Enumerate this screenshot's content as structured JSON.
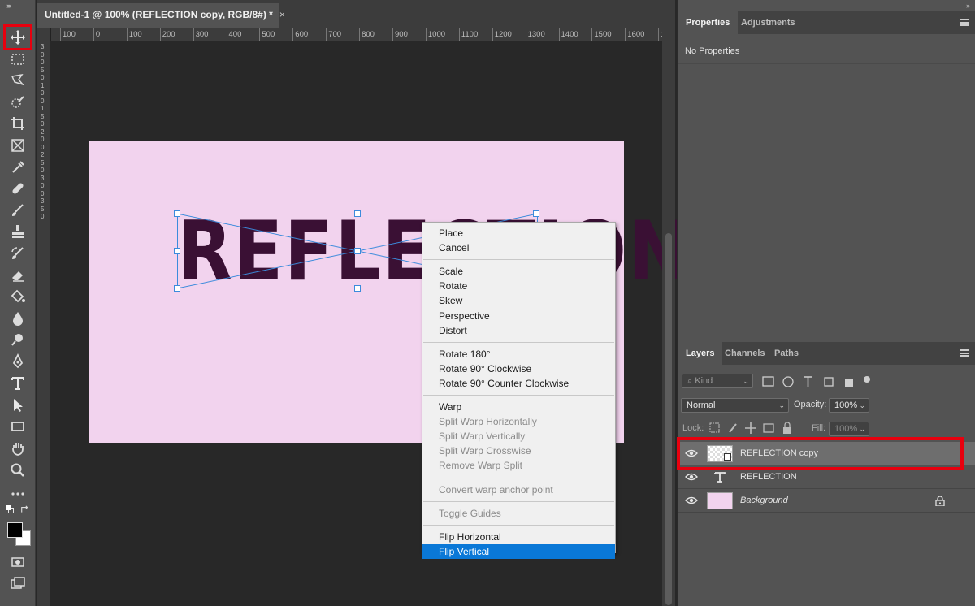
{
  "document_tab": {
    "title": "Untitled-1 @ 100% (REFLECTION copy, RGB/8#) *",
    "close": "×"
  },
  "ruler": {
    "h_ticks": [
      "100",
      "0",
      "100",
      "200",
      "300",
      "400",
      "500",
      "600",
      "700",
      "800",
      "900",
      "1000",
      "1100",
      "1200",
      "1300",
      "1400",
      "1500",
      "1600",
      "1700"
    ],
    "v_ticks": [
      "3",
      "0",
      "0",
      "5",
      "0",
      "1",
      "0",
      "0",
      "1",
      "5",
      "0",
      "2",
      "0",
      "0",
      "2",
      "5",
      "0",
      "3",
      "0",
      "0",
      "3",
      "5",
      "0"
    ]
  },
  "canvas": {
    "text": "REFLECTION",
    "background_color": "#f2d3ee",
    "text_color": "#3a1034"
  },
  "context_menu": {
    "groups": [
      [
        {
          "label": "Place",
          "enabled": true
        },
        {
          "label": "Cancel",
          "enabled": true
        }
      ],
      [
        {
          "label": "Scale",
          "enabled": true
        },
        {
          "label": "Rotate",
          "enabled": true
        },
        {
          "label": "Skew",
          "enabled": true
        },
        {
          "label": "Perspective",
          "enabled": true
        },
        {
          "label": "Distort",
          "enabled": true
        }
      ],
      [
        {
          "label": "Rotate 180°",
          "enabled": true
        },
        {
          "label": "Rotate 90° Clockwise",
          "enabled": true
        },
        {
          "label": "Rotate 90° Counter Clockwise",
          "enabled": true
        }
      ],
      [
        {
          "label": "Warp",
          "enabled": true
        },
        {
          "label": "Split Warp Horizontally",
          "enabled": false
        },
        {
          "label": "Split Warp Vertically",
          "enabled": false
        },
        {
          "label": "Split Warp Crosswise",
          "enabled": false
        },
        {
          "label": "Remove Warp Split",
          "enabled": false
        }
      ],
      [
        {
          "label": "Convert warp anchor point",
          "enabled": false
        }
      ],
      [
        {
          "label": "Toggle Guides",
          "enabled": false
        }
      ],
      [
        {
          "label": "Flip Horizontal",
          "enabled": true
        },
        {
          "label": "Flip Vertical",
          "enabled": true,
          "selected": true
        }
      ]
    ]
  },
  "properties_panel": {
    "tabs": [
      "Properties",
      "Adjustments"
    ],
    "active_tab": "Properties",
    "content": "No Properties"
  },
  "layers_panel": {
    "tabs": [
      "Layers",
      "Channels",
      "Paths"
    ],
    "active_tab": "Layers",
    "filter_placeholder": "Kind",
    "blend_mode": "Normal",
    "opacity_label": "Opacity:",
    "opacity_value": "100%",
    "lock_label": "Lock:",
    "fill_label": "Fill:",
    "fill_value": "100%",
    "layers": [
      {
        "name": "REFLECTION copy",
        "type": "smart-object",
        "selected": true
      },
      {
        "name": "REFLECTION",
        "type": "text",
        "selected": false
      },
      {
        "name": "Background",
        "type": "background",
        "selected": false,
        "italic": true,
        "locked": true
      }
    ]
  },
  "colors": {
    "accent_selected": "#0a78d7",
    "highlight_red": "#e8000e",
    "foreground": "#000000",
    "background": "#ffffff"
  }
}
